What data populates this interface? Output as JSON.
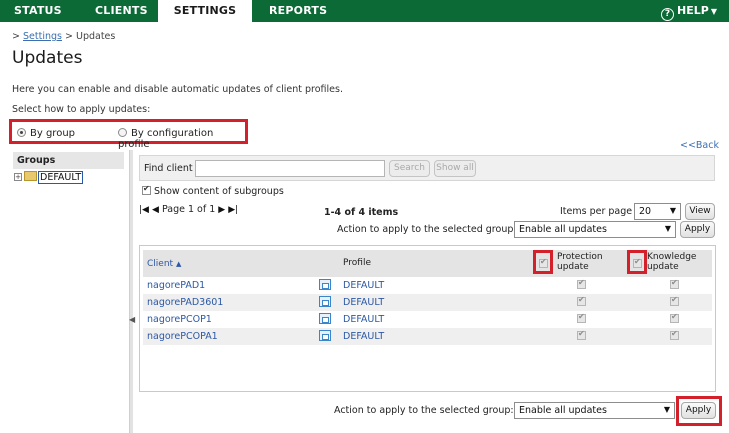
{
  "nav": {
    "tabs": [
      {
        "label": "STATUS"
      },
      {
        "label": "CLIENTS"
      },
      {
        "label": "SETTINGS"
      },
      {
        "label": "REPORTS"
      }
    ],
    "help_label": "HELP",
    "active_tab": "SETTINGS",
    "bg_color": "#0c6a36"
  },
  "breadcrumb": {
    "prefix": ">",
    "link": "Settings",
    "sep": ">",
    "current": "Updates"
  },
  "page_title": "Updates",
  "description": "Here you can enable and disable automatic updates of client profiles.",
  "select_how": "Select how to apply updates:",
  "apply_mode": {
    "options": [
      {
        "label": "By group",
        "selected": true
      },
      {
        "label": "By configuration profile",
        "selected": false
      }
    ]
  },
  "back_link": "<<Back",
  "groups": {
    "header": "Groups",
    "tree": [
      {
        "label": "DEFAULT",
        "selected": true
      }
    ]
  },
  "find": {
    "label": "Find client",
    "value": "",
    "search_label": "Search",
    "show_all_label": "Show all"
  },
  "subgroups": {
    "label": "Show content of subgroups",
    "checked": true
  },
  "pager": {
    "first": "|◀",
    "prev": "◀",
    "text": "Page 1 of 1",
    "next": "▶",
    "last": "▶|",
    "count": "1-4 of 4 items"
  },
  "items_per_page": {
    "label": "Items per page",
    "value": "20",
    "view_label": "View"
  },
  "action_top": {
    "label": "Action to apply to the selected group:",
    "value": "Enable all updates",
    "apply_label": "Apply"
  },
  "table": {
    "columns": {
      "client": "Client",
      "sort": "▲",
      "profile": "Profile",
      "protection": "Protection update",
      "knowledge": "Knowledge update"
    },
    "rows": [
      {
        "client": "nagorePAD1",
        "profile": "DEFAULT",
        "protection": true,
        "knowledge": true
      },
      {
        "client": "nagorePAD3601",
        "profile": "DEFAULT",
        "protection": true,
        "knowledge": true
      },
      {
        "client": "nagorePCOP1",
        "profile": "DEFAULT",
        "protection": true,
        "knowledge": true
      },
      {
        "client": "nagorePCOPA1",
        "profile": "DEFAULT",
        "protection": true,
        "knowledge": true
      }
    ]
  },
  "action_bottom": {
    "label": "Action to apply to the selected group:",
    "value": "Enable all updates",
    "apply_label": "Apply"
  },
  "highlight_color": "#d3202a"
}
